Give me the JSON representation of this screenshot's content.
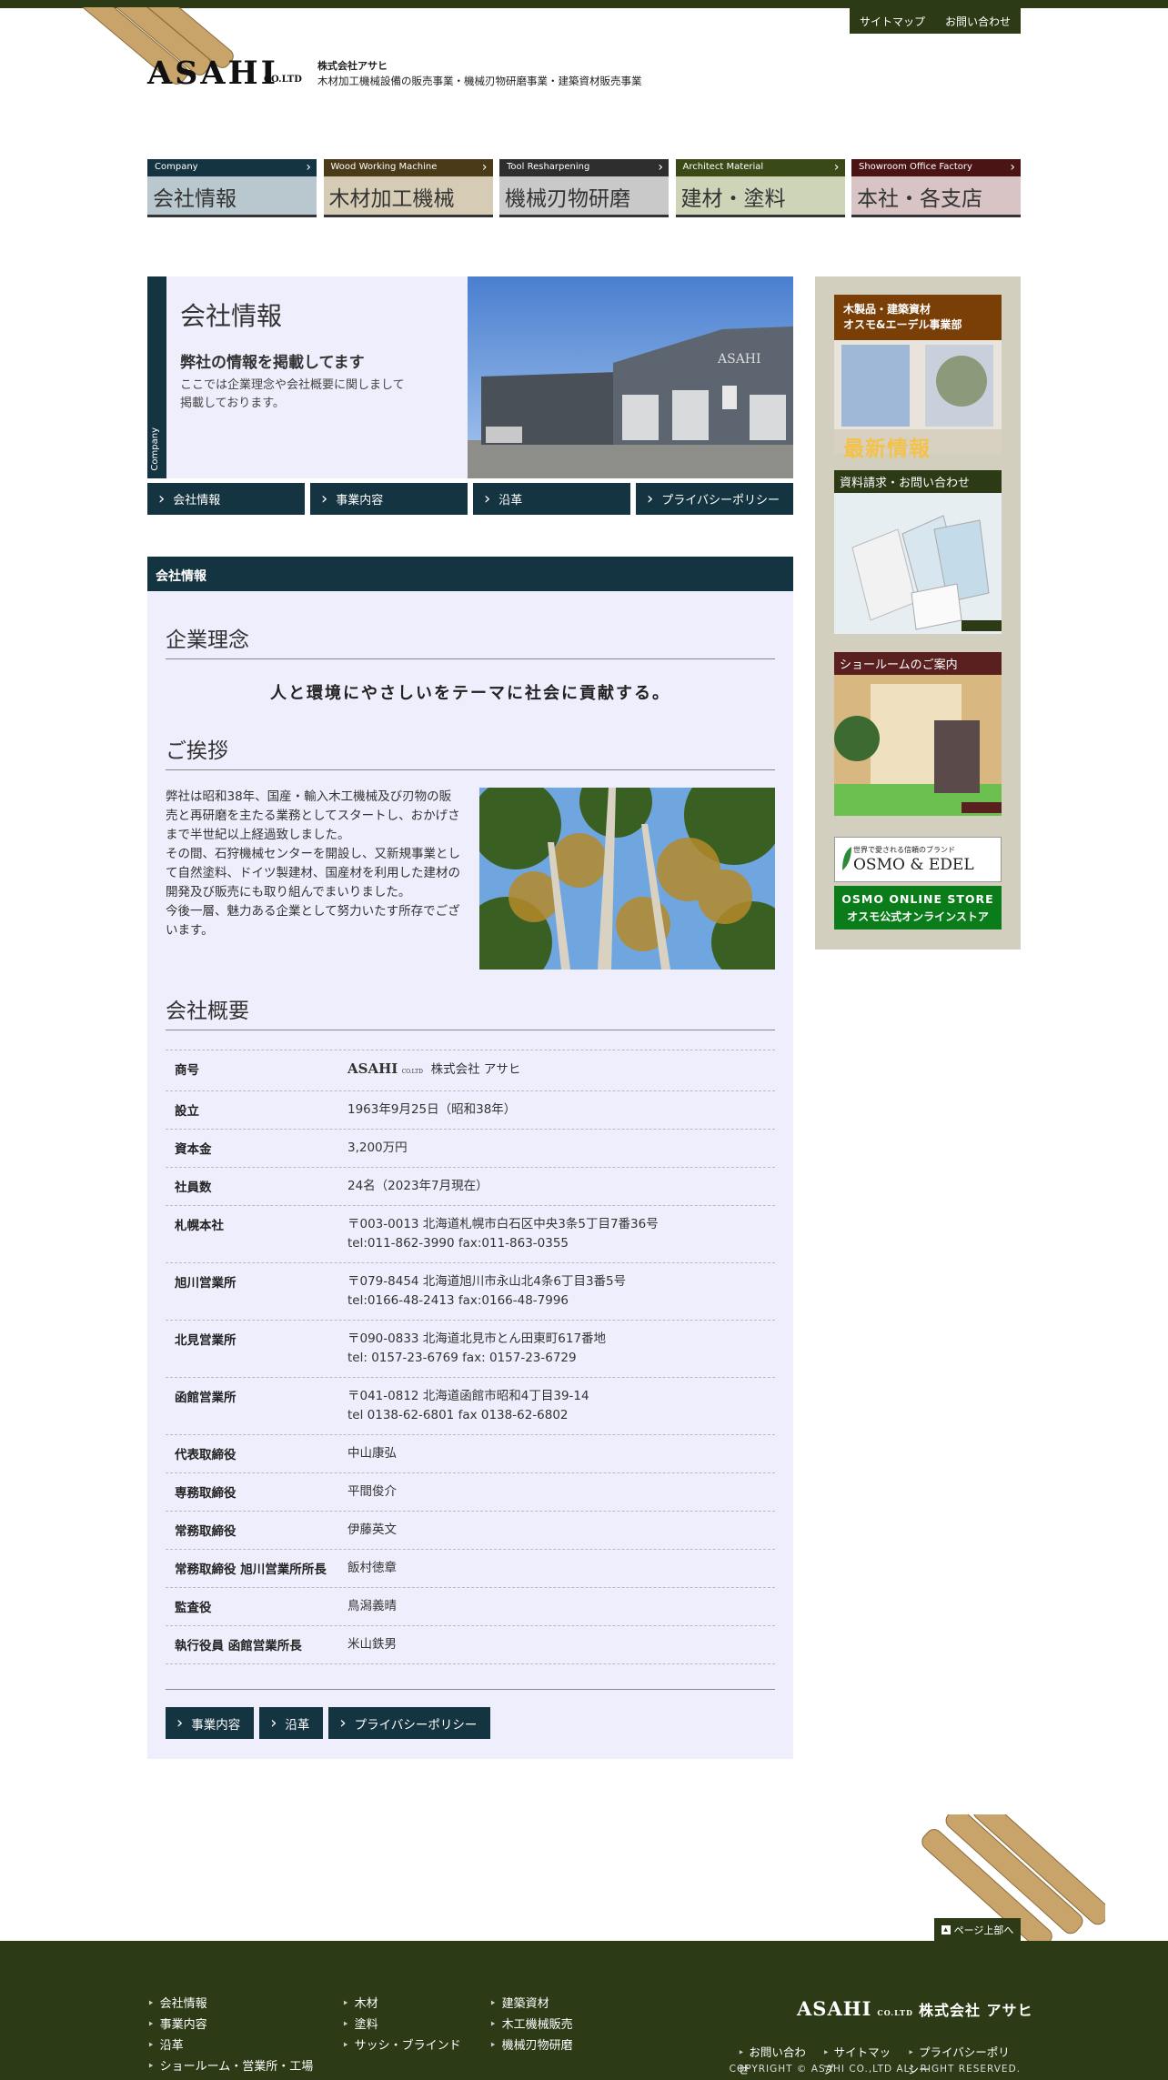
{
  "header": {
    "util_links": [
      "サイトマップ",
      "お問い合わせ"
    ],
    "logo": "ASAHI",
    "logo_co": "CO.LTD",
    "company_name": "株式会社アサヒ",
    "company_desc": "木材加工機械設備の販売事業・機械刃物研磨事業・建築資材販売事業"
  },
  "gnav": [
    {
      "en": "Company",
      "ja": "会社情報",
      "head_color": "#153441",
      "body_color": "#b8c8ce"
    },
    {
      "en": "Wood Working Machine",
      "ja": "木材加工機械",
      "head_color": "#4a3a18",
      "body_color": "#d6ccb6"
    },
    {
      "en": "Tool Resharpening",
      "ja": "機械刃物研磨",
      "head_color": "#2e2e2e",
      "body_color": "#c9c9c9"
    },
    {
      "en": "Architect Material",
      "ja": "建材・塗料",
      "head_color": "#3a4a16",
      "body_color": "#cdd4b8"
    },
    {
      "en": "Showroom Office Factory",
      "ja": "本社・各支店",
      "head_color": "#4a1414",
      "body_color": "#d8c4c4"
    }
  ],
  "hero": {
    "side_label": "Company",
    "title": "会社情報",
    "subtitle": "弊社の情報を掲載してます",
    "text": "ここでは企業理念や会社概要に関しまして掲載しております。"
  },
  "subnav": [
    "会社情報",
    "事業内容",
    "沿革",
    "プライバシーポリシー"
  ],
  "section": {
    "head": "会社情報",
    "philosophy_title": "企業理念",
    "motto": "人と環境にやさしいをテーマに社会に貢献する。",
    "greeting_title": "ご挨拶",
    "greeting_text": "弊社は昭和38年、国産・輸入木工機械及び刃物の販売と再研磨を主たる業務としてスタートし、おかげさまで半世紀以上経過致しました。\nその間、石狩機械センターを開設し、又新規事業として自然塗料、ドイツ製建材、国産材を利用した建材の開発及び販売にも取り組んでまいりました。\n今後一層、魅力ある企業として努力いたす所存でございます。",
    "overview_title": "会社概要",
    "table": [
      {
        "k": "商号",
        "v": "株式会社 アサヒ",
        "logo": "ASAHI",
        "logo_co": "CO.LTD"
      },
      {
        "k": "設立",
        "v": "1963年9月25日（昭和38年）"
      },
      {
        "k": "資本金",
        "v": "3,200万円"
      },
      {
        "k": "社員数",
        "v": "24名（2023年7月現在）"
      },
      {
        "k": "札幌本社",
        "v": "〒003-0013 北海道札幌市白石区中央3条5丁目7番36号",
        "v2": "tel:011-862-3990 fax:011-863-0355"
      },
      {
        "k": "旭川営業所",
        "v": "〒079-8454 北海道旭川市永山北4条6丁目3番5号",
        "v2": "tel:0166-48-2413 fax:0166-48-7996"
      },
      {
        "k": "北見営業所",
        "v": "〒090-0833 北海道北見市とん田東町617番地",
        "v2": "tel: 0157-23-6769 fax: 0157-23-6729"
      },
      {
        "k": "函館営業所",
        "v": "〒041-0812 北海道函館市昭和4丁目39-14",
        "v2": "tel 0138-62-6801 fax 0138-62-6802"
      },
      {
        "k": "代表取締役",
        "v": "中山康弘"
      },
      {
        "k": "専務取締役",
        "v": "平間俊介"
      },
      {
        "k": "常務取締役",
        "v": "伊藤英文"
      },
      {
        "k": "常務取締役 旭川営業所所長",
        "v": "飯村徳章"
      },
      {
        "k": "監査役",
        "v": "鳥潟義晴"
      },
      {
        "k": "執行役員 函館営業所長",
        "v": "米山鉄男"
      }
    ],
    "bottom_buttons": [
      "事業内容",
      "沿革",
      "プライバシーポリシー"
    ]
  },
  "sidebar": {
    "news_head": "木製品・建築資材\nオスモ&エーデル事業部",
    "news_title": "最新情報",
    "request_head": "資料請求・お問い合わせ",
    "showroom_head": "ショールームのご案内",
    "osmo_tagline": "世界で愛される信頼のブランド",
    "osmo_brand": "OSMO & EDEL",
    "store_en": "OSMO ONLINE STORE",
    "store_ja": "オスモ公式オンラインストア"
  },
  "pagetop": "ページ上部へ",
  "footer": {
    "col1": [
      "会社情報",
      "事業内容",
      "沿革",
      "ショールーム・営業所・工場"
    ],
    "col2": [
      "木材",
      "塗料",
      "サッシ・ブラインド"
    ],
    "col3": [
      "建築資材",
      "木工機械販売",
      "機械刃物研磨"
    ],
    "logo": "ASAHI",
    "logo_co": "CO.LTD",
    "logo_ja": "株式会社 アサヒ",
    "links": [
      "お問い合わせ",
      "サイトマップ",
      "プライバシーポリシー"
    ],
    "copyright": "COPYRIGHT © ASAHI CO.,LTD ALL RIGHT RESERVED."
  }
}
